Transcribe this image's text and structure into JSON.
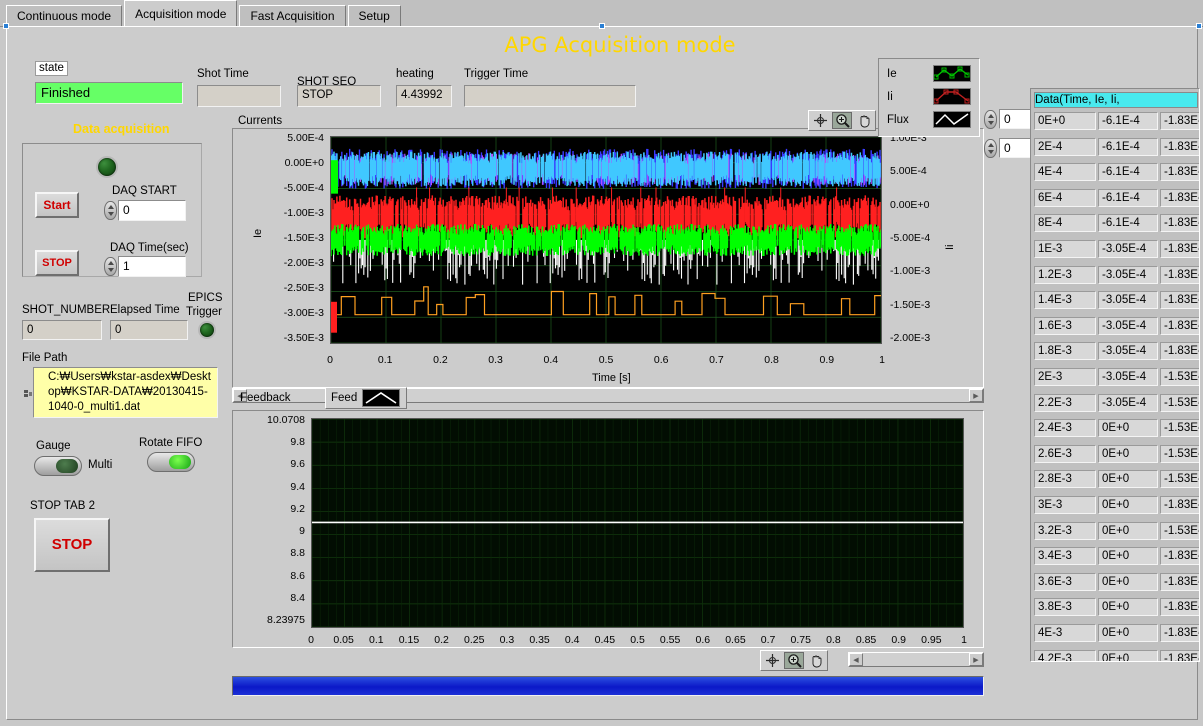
{
  "window": {
    "title": "APG Acquisition mode"
  },
  "tabs": [
    {
      "label": "Continuous mode",
      "active": false
    },
    {
      "label": "Acquisition mode",
      "active": true
    },
    {
      "label": "Fast Acquisition",
      "active": false
    },
    {
      "label": "Setup",
      "active": false
    }
  ],
  "status": {
    "state_caption": "state",
    "state_value": "Finished",
    "state_color": "#66ff66"
  },
  "fields": {
    "shot_time_label": "Shot Time",
    "shot_time_value": "",
    "shot_seq_label": "SHOT SEQ",
    "shot_seq_value": "STOP",
    "heating_label": "heating",
    "heating_value": "4.43992",
    "trigger_time_label": "Trigger Time",
    "trigger_time_value": ""
  },
  "data_acquisition": {
    "panel_title": "Data acquisition",
    "start_button": "Start",
    "stop_button": "STOP",
    "daq_start_label": "DAQ START",
    "daq_start_value": "0",
    "daq_time_label": "DAQ Time(sec)",
    "daq_time_value": "1",
    "led_name": "acquisition-led"
  },
  "shot_info": {
    "shot_number_label": "SHOT_NUMBER",
    "shot_number_value": "0",
    "elapsed_time_label": "Elapsed Time",
    "elapsed_time_value": "0",
    "epics_trigger_label_1": "EPICS",
    "epics_trigger_label_2": "Trigger"
  },
  "file": {
    "path_label": "File Path",
    "path_value": "C:₩Users₩kstar-asdex₩Desktop₩KSTAR-DATA₩20130415-1040-0_multi1.dat"
  },
  "toggles": {
    "gauge_label": "Gauge",
    "gauge_value": "Multi",
    "rotate_fifo_label": "Rotate FIFO"
  },
  "stop_tab": {
    "label": "STOP TAB 2",
    "button": "STOP"
  },
  "currents_graph": {
    "label": "Currents",
    "legend": [
      {
        "name": "Ie",
        "color": "#00d000"
      },
      {
        "name": "Ii",
        "color": "#d00000"
      },
      {
        "name": "Flux",
        "color": "#ffffff"
      }
    ],
    "spinner_1_value": "0",
    "spinner_2_value": "0",
    "palette": [
      "crosshair-cursor-icon",
      "zoom-icon",
      "pan-hand-icon"
    ],
    "selected_palette_tool": "zoom-icon"
  },
  "feedback_graph": {
    "label": "Feedback",
    "legend_name": "Feed",
    "palette": [
      "crosshair-cursor-icon",
      "zoom-icon",
      "pan-hand-icon"
    ],
    "selected_palette_tool": "zoom-icon"
  },
  "table": {
    "header": "Data(Time,  Ie,            Ii,",
    "columns": [
      "Time",
      "Ie",
      "Ii"
    ],
    "rows": [
      [
        "0E+0",
        "-6.1E-4",
        "-1.83E-"
      ],
      [
        "2E-4",
        "-6.1E-4",
        "-1.83E-"
      ],
      [
        "4E-4",
        "-6.1E-4",
        "-1.83E-"
      ],
      [
        "6E-4",
        "-6.1E-4",
        "-1.83E-"
      ],
      [
        "8E-4",
        "-6.1E-4",
        "-1.83E-"
      ],
      [
        "1E-3",
        "-3.05E-4",
        "-1.83E-"
      ],
      [
        "1.2E-3",
        "-3.05E-4",
        "-1.83E-"
      ],
      [
        "1.4E-3",
        "-3.05E-4",
        "-1.83E-"
      ],
      [
        "1.6E-3",
        "-3.05E-4",
        "-1.83E-"
      ],
      [
        "1.8E-3",
        "-3.05E-4",
        "-1.83E-"
      ],
      [
        "2E-3",
        "-3.05E-4",
        "-1.53E-"
      ],
      [
        "2.2E-3",
        "-3.05E-4",
        "-1.53E-"
      ],
      [
        "2.4E-3",
        "0E+0",
        "-1.53E-"
      ],
      [
        "2.6E-3",
        "0E+0",
        "-1.53E-"
      ],
      [
        "2.8E-3",
        "0E+0",
        "-1.53E-"
      ],
      [
        "3E-3",
        "0E+0",
        "-1.83E-"
      ],
      [
        "3.2E-3",
        "0E+0",
        "-1.53E-"
      ],
      [
        "3.4E-3",
        "0E+0",
        "-1.83E-"
      ],
      [
        "3.6E-3",
        "0E+0",
        "-1.83E-"
      ],
      [
        "3.8E-3",
        "0E+0",
        "-1.83E-"
      ],
      [
        "4E-3",
        "0E+0",
        "-1.83E-"
      ],
      [
        "4.2E-3",
        "0E+0",
        "-1.83E-"
      ]
    ]
  },
  "chart_data": [
    {
      "type": "line",
      "name": "currents-graph",
      "title": "Currents",
      "xlabel": "Time [s]",
      "ylabel": "Ie",
      "y2label": "Ii",
      "xlim": [
        0,
        1
      ],
      "xticks": [
        "0",
        "0.1",
        "0.2",
        "0.3",
        "0.4",
        "0.5",
        "0.6",
        "0.7",
        "0.8",
        "0.9",
        "1"
      ],
      "ylim": [
        -0.0035,
        0.0005
      ],
      "yticks": [
        "5.00E-4",
        "0.00E+0",
        "-5.00E-4",
        "-1.00E-3",
        "-1.50E-3",
        "-2.00E-3",
        "-2.50E-3",
        "-3.00E-3",
        "-3.50E-3"
      ],
      "y2lim": [
        -0.002,
        0.001
      ],
      "y2ticks": [
        "1.00E-3",
        "5.00E-4",
        "0.00E+0",
        "-5.00E-4",
        "-1.00E-3",
        "-1.50E-3",
        "-2.00E-3"
      ],
      "grid": true,
      "plot_bg": "#000000",
      "grid_color": "#1f5a1f",
      "legend_position": "top-right",
      "series": [
        {
          "name": "Ie",
          "color": "#00ff00",
          "band_center": -0.00155,
          "band_height": 0.00022,
          "style": "noisy-band"
        },
        {
          "name": "Ii",
          "color": "#ff2020",
          "band_center": -0.00105,
          "band_height": 0.0003,
          "style": "noisy-band"
        },
        {
          "name": "Flux",
          "color": "#ffffff",
          "band_center": -0.0017,
          "band_height": 0.00028,
          "style": "spikes"
        },
        {
          "name": "trace-cyan",
          "color": "#40c8ff",
          "band_center": -0.00012,
          "band_height": 0.00028,
          "style": "noisy-band"
        },
        {
          "name": "trace-blue",
          "color": "#4040ff",
          "band_center": -0.0001,
          "band_height": 0.00022,
          "style": "noisy-band"
        },
        {
          "name": "trace-magenta",
          "color": "#d060ff",
          "band_center": -0.00014,
          "band_height": 0.00016,
          "style": "noisy-band"
        },
        {
          "name": "trace-orange",
          "color": "#ffa020",
          "band_center": -0.0028,
          "band_height": 0.0002,
          "style": "square-wave"
        }
      ]
    },
    {
      "type": "line",
      "name": "feedback-graph",
      "title": "Feedback",
      "xlabel": "",
      "ylabel": "",
      "xlim": [
        0,
        1
      ],
      "xticks": [
        "0",
        "0.05",
        "0.1",
        "0.15",
        "0.2",
        "0.25",
        "0.3",
        "0.35",
        "0.4",
        "0.45",
        "0.5",
        "0.55",
        "0.6",
        "0.65",
        "0.7",
        "0.75",
        "0.8",
        "0.85",
        "0.9",
        "0.95",
        "1"
      ],
      "ylim": [
        8.23975,
        10.0708
      ],
      "yticks": [
        "10.0708",
        "9.8",
        "9.6",
        "9.4",
        "9.2",
        "9",
        "8.8",
        "8.6",
        "8.4",
        "8.23975"
      ],
      "grid": true,
      "plot_bg": "#020d02",
      "grid_color": "#14400f",
      "series": [
        {
          "name": "Feed",
          "color": "#ffffff",
          "constant_value": 9.16,
          "style": "flat-line"
        }
      ]
    }
  ],
  "progress": {
    "name": "run-progress-bar",
    "value_pct": 100,
    "color": "#1020d8"
  }
}
